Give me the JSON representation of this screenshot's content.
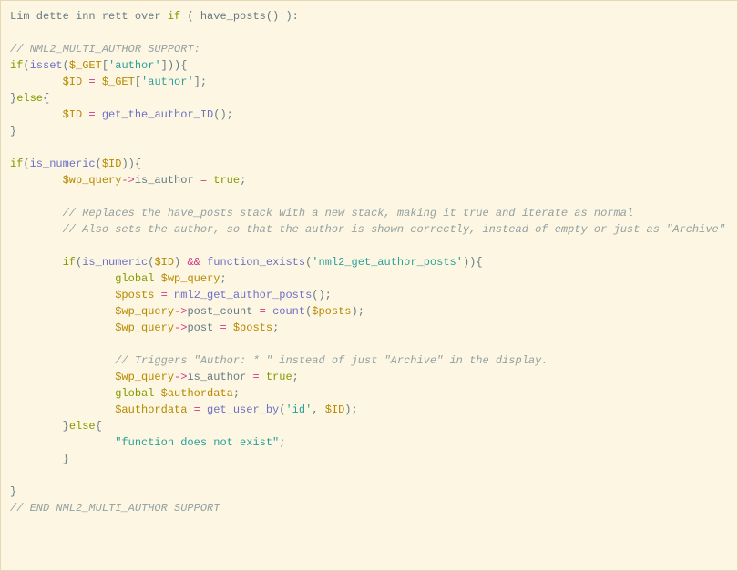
{
  "code": {
    "l01a": "Lim dette inn rett over ",
    "l01b": "if",
    "l01c": " ( have_posts() ):",
    "l02": "",
    "l03": "// NML2_MULTI_AUTHOR SUPPORT:",
    "l04_if": "if",
    "l04_isset": "isset",
    "l04_get": "$_GET",
    "l04_key": "'author'",
    "l05_id": "$ID",
    "l05_eq": "=",
    "l05_get": "$_GET",
    "l05_key": "'author'",
    "l06_else": "else",
    "l07_id": "$ID",
    "l07_eq": "=",
    "l07_fn": "get_the_author_ID",
    "l09_if": "if",
    "l09_isnum": "is_numeric",
    "l09_id": "$ID",
    "l10_wpq": "$wp_query",
    "l10_arrow": "->",
    "l10_isauth": "is_author ",
    "l10_eq": "=",
    "l10_true": " true",
    "l12c": "// Replaces the have_posts stack with a new stack, making it true and iterate as normal",
    "l13c": "// Also sets the author, so that the author is shown correctly, instead of empty or just as \"Archive\"",
    "l15_if": "if",
    "l15_isnum": "is_numeric",
    "l15_id": "$ID",
    "l15_amp": "&&",
    "l15_fex": "function_exists",
    "l15_str": "'nml2_get_author_posts'",
    "l16_global": "global",
    "l16_wpq": "$wp_query",
    "l17_posts": "$posts",
    "l17_eq": "=",
    "l17_fn": "nml2_get_author_posts",
    "l18_wpq": "$wp_query",
    "l18_arrow": "->",
    "l18_pc": "post_count ",
    "l18_eq": "=",
    "l18_count": "count",
    "l18_posts": "$posts",
    "l19_wpq": "$wp_query",
    "l19_arrow": "->",
    "l19_post": "post ",
    "l19_eq": "=",
    "l19_posts": "$posts",
    "l21c": "// Triggers \"Author: * \" instead of just \"Archive\" in the display.",
    "l22_wpq": "$wp_query",
    "l22_arrow": "->",
    "l22_isauth": "is_author ",
    "l22_eq": "=",
    "l22_true": " true",
    "l23_global": "global",
    "l23_auth": "$authordata",
    "l24_auth": "$authordata",
    "l24_eq": "=",
    "l24_fn": "get_user_by",
    "l24_s1": "'id'",
    "l24_id": "$ID",
    "l25_else": "else",
    "l26_str": "\"function does not exist\"",
    "l30c": "// END NML2_MULTI_AUTHOR SUPPORT"
  }
}
